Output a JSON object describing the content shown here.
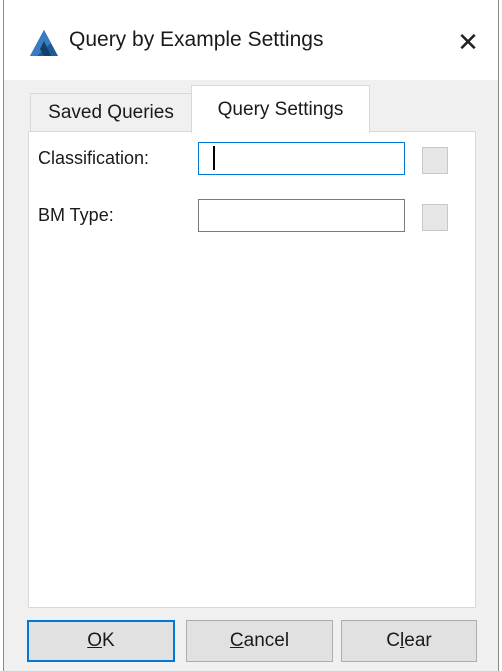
{
  "window": {
    "title": "Query by Example Settings",
    "close_glyph": "✕",
    "app_icon": "triangle-logo-icon",
    "accent_color": "#0078d7"
  },
  "tabs": [
    {
      "label": "Saved Queries",
      "active": false
    },
    {
      "label": "Query Settings",
      "active": true
    }
  ],
  "fields": [
    {
      "label": "Classification:",
      "value": "",
      "placeholder": "",
      "focused": true
    },
    {
      "label": "BM Type:",
      "value": "",
      "placeholder": "",
      "focused": false
    }
  ],
  "buttons": {
    "ok": {
      "mnemonic": "O",
      "rest": "K",
      "default": true
    },
    "cancel": {
      "mnemonic": "C",
      "rest": "ancel"
    },
    "clear": {
      "pre": "C",
      "mnemonic": "l",
      "rest": "ear"
    }
  }
}
